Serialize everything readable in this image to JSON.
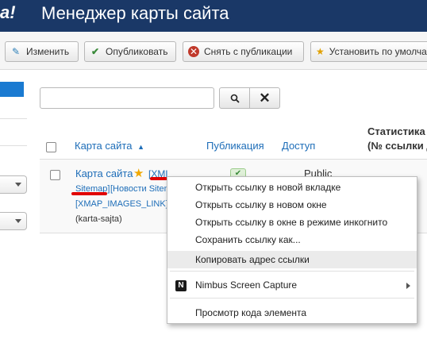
{
  "header": {
    "logo_fragment": "a!",
    "title": "Менеджер карты сайта"
  },
  "toolbar": {
    "edit_label": "Изменить",
    "publish_label": "Опубликовать",
    "unpublish_label": "Снять с публикации",
    "default_label": "Установить по умолча",
    "icons": [
      "edit-icon",
      "check-icon",
      "close-circle-icon",
      "star-icon"
    ]
  },
  "search": {
    "value": "",
    "placeholder": ""
  },
  "table": {
    "headers": {
      "sitemap": "Карта сайта",
      "published": "Публикация",
      "access": "Доступ",
      "stats_line1": "Статистика",
      "stats_line2": "(№ ссылки д"
    },
    "sort_indicator": "▲",
    "row": {
      "title": "Карта сайта",
      "link_xml_part1": "[XML",
      "link_xml_part2": "Sitemap]",
      "link_news": "[Новости Siten",
      "link_images": "[XMAP_IMAGES_LINK]",
      "alias": "(karta-sajta)",
      "access": "Public"
    }
  },
  "context_menu": {
    "items": [
      "Открыть ссылку в новой вкладке",
      "Открыть ссылку в новом окне",
      "Открыть ссылку в окне в режиме инкогнито",
      "Сохранить ссылку как...",
      "Копировать адрес ссылки",
      "Nimbus Screen Capture",
      "Просмотр кода элемента"
    ],
    "highlighted_index": 4,
    "nimbus_icon_letter": "N"
  },
  "colors": {
    "header_bg": "#1a3867",
    "link": "#1d6db8",
    "annotation_red": "#e00000"
  }
}
